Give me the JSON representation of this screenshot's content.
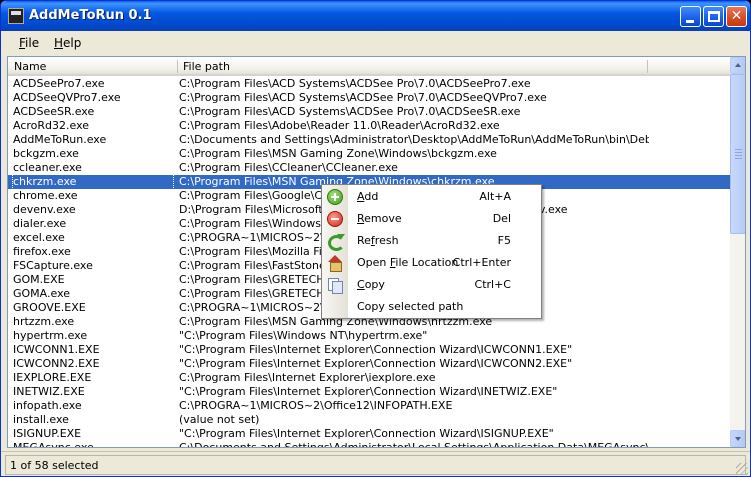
{
  "window": {
    "title": "AddMeToRun 0.1"
  },
  "menu": {
    "file": "File",
    "help": "Help"
  },
  "columns": {
    "name": "Name",
    "path": "File path"
  },
  "rows": [
    {
      "name": "ACDSeePro7.exe",
      "path": "C:\\Program Files\\ACD Systems\\ACDSee Pro\\7.0\\ACDSeePro7.exe"
    },
    {
      "name": "ACDSeeQVPro7.exe",
      "path": "C:\\Program Files\\ACD Systems\\ACDSee Pro\\7.0\\ACDSeeQVPro7.exe"
    },
    {
      "name": "ACDSeeSR.exe",
      "path": "C:\\Program Files\\ACD Systems\\ACDSee Pro\\7.0\\ACDSeeSR.exe"
    },
    {
      "name": "AcroRd32.exe",
      "path": "C:\\Program Files\\Adobe\\Reader 11.0\\Reader\\AcroRd32.exe"
    },
    {
      "name": "AddMeToRun.exe",
      "path": "C:\\Documents and Settings\\Administrator\\Desktop\\AddMeToRun\\AddMeToRun\\bin\\Debug\\..."
    },
    {
      "name": "bckgzm.exe",
      "path": "C:\\Program Files\\MSN Gaming Zone\\Windows\\bckgzm.exe"
    },
    {
      "name": "ccleaner.exe",
      "path": "C:\\Program Files\\CCleaner\\CCleaner.exe"
    },
    {
      "name": "chkrzm.exe",
      "path": "C:\\Program Files\\MSN Gaming Zone\\Windows\\chkrzm.exe",
      "selected": true
    },
    {
      "name": "chrome.exe",
      "path": "C:\\Program Files\\Google\\Chrome\\Application\\chrome.exe"
    },
    {
      "name": "devenv.exe",
      "path": "D:\\Program Files\\Microsoft Visual Studio 9.0\\Common7\\IDE\\devenv.exe"
    },
    {
      "name": "dialer.exe",
      "path": "C:\\Program Files\\Windows NT\\dialer.exe"
    },
    {
      "name": "excel.exe",
      "path": "C:\\PROGRA~1\\MICROS~2\\Office12\\EXCEL.EXE"
    },
    {
      "name": "firefox.exe",
      "path": "C:\\Program Files\\Mozilla Firefox\\firefox.exe"
    },
    {
      "name": "FSCapture.exe",
      "path": "C:\\Program Files\\FastStone Capture\\FSCapture.exe"
    },
    {
      "name": "GOM.EXE",
      "path": "C:\\Program Files\\GRETECH\\GomPlayer\\GOM.EXE"
    },
    {
      "name": "GOMA.exe",
      "path": "C:\\Program Files\\GRETECH\\GomAudio\\GOMA.exe"
    },
    {
      "name": "GROOVE.EXE",
      "path": "C:\\PROGRA~1\\MICROS~2\\Office12\\GROOVE.EXE"
    },
    {
      "name": "hrtzzm.exe",
      "path": "C:\\Program Files\\MSN Gaming Zone\\Windows\\hrtzzm.exe"
    },
    {
      "name": "hypertrm.exe",
      "path": "\"C:\\Program Files\\Windows NT\\hypertrm.exe\""
    },
    {
      "name": "ICWCONN1.EXE",
      "path": "\"C:\\Program Files\\Internet Explorer\\Connection Wizard\\ICWCONN1.EXE\""
    },
    {
      "name": "ICWCONN2.EXE",
      "path": "\"C:\\Program Files\\Internet Explorer\\Connection Wizard\\ICWCONN2.EXE\""
    },
    {
      "name": "IEXPLORE.EXE",
      "path": "C:\\Program Files\\Internet Explorer\\iexplore.exe"
    },
    {
      "name": "INETWIZ.EXE",
      "path": "\"C:\\Program Files\\Internet Explorer\\Connection Wizard\\INETWIZ.EXE\""
    },
    {
      "name": "infopath.exe",
      "path": "C:\\PROGRA~1\\MICROS~2\\Office12\\INFOPATH.EXE"
    },
    {
      "name": "install.exe",
      "path": "(value not set)"
    },
    {
      "name": "ISIGNUP.EXE",
      "path": "\"C:\\Program Files\\Internet Explorer\\Connection Wizard\\ISIGNUP.EXE\""
    },
    {
      "name": "MEGAsync.exe",
      "path": "C:\\Documents and Settings\\Administrator\\Local Settings\\Application Data\\MEGAsync\\MEGAs..."
    }
  ],
  "status": {
    "text": "1 of 58 selected"
  },
  "context_menu": {
    "items": [
      {
        "pre": "",
        "ul": "A",
        "post": "dd",
        "shortcut": "Alt+A",
        "icon": "add-icon"
      },
      {
        "pre": "",
        "ul": "R",
        "post": "emove",
        "shortcut": "Del",
        "icon": "remove-icon"
      },
      {
        "pre": "Re",
        "ul": "f",
        "post": "resh",
        "shortcut": "F5",
        "icon": "refresh-icon"
      },
      {
        "pre": "Open ",
        "ul": "F",
        "post": "ile Location",
        "shortcut": "Ctrl+Enter",
        "icon": "home-icon"
      },
      {
        "pre": "",
        "ul": "C",
        "post": "opy",
        "shortcut": "Ctrl+C",
        "icon": "copy-icon"
      },
      {
        "pre": "Copy selected path",
        "ul": "",
        "post": "",
        "shortcut": "",
        "icon": ""
      }
    ]
  }
}
